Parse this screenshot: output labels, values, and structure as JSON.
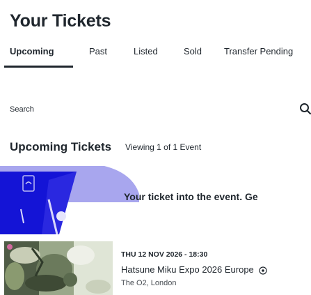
{
  "page": {
    "title": "Your Tickets"
  },
  "tabs": [
    {
      "label": "Upcoming",
      "active": true
    },
    {
      "label": "Past",
      "active": false
    },
    {
      "label": "Listed",
      "active": false
    },
    {
      "label": "Sold",
      "active": false
    },
    {
      "label": "Transfer Pending",
      "active": false
    }
  ],
  "search": {
    "label": "Search",
    "icon": "search-icon"
  },
  "section": {
    "title": "Upcoming Tickets",
    "count_text": "Viewing 1 of 1 Event"
  },
  "banner": {
    "text": "Your ticket into the event. Ge",
    "colors": {
      "primary": "#1414d6",
      "light": "#a8a6ee",
      "mid": "#6e6ce0"
    }
  },
  "event": {
    "date": "THU 12 NOV 2026 - 18:30",
    "name": "Hatsune Miku Expo 2026 Europe",
    "venue": "The O2, London",
    "info_icon": "info-icon"
  }
}
